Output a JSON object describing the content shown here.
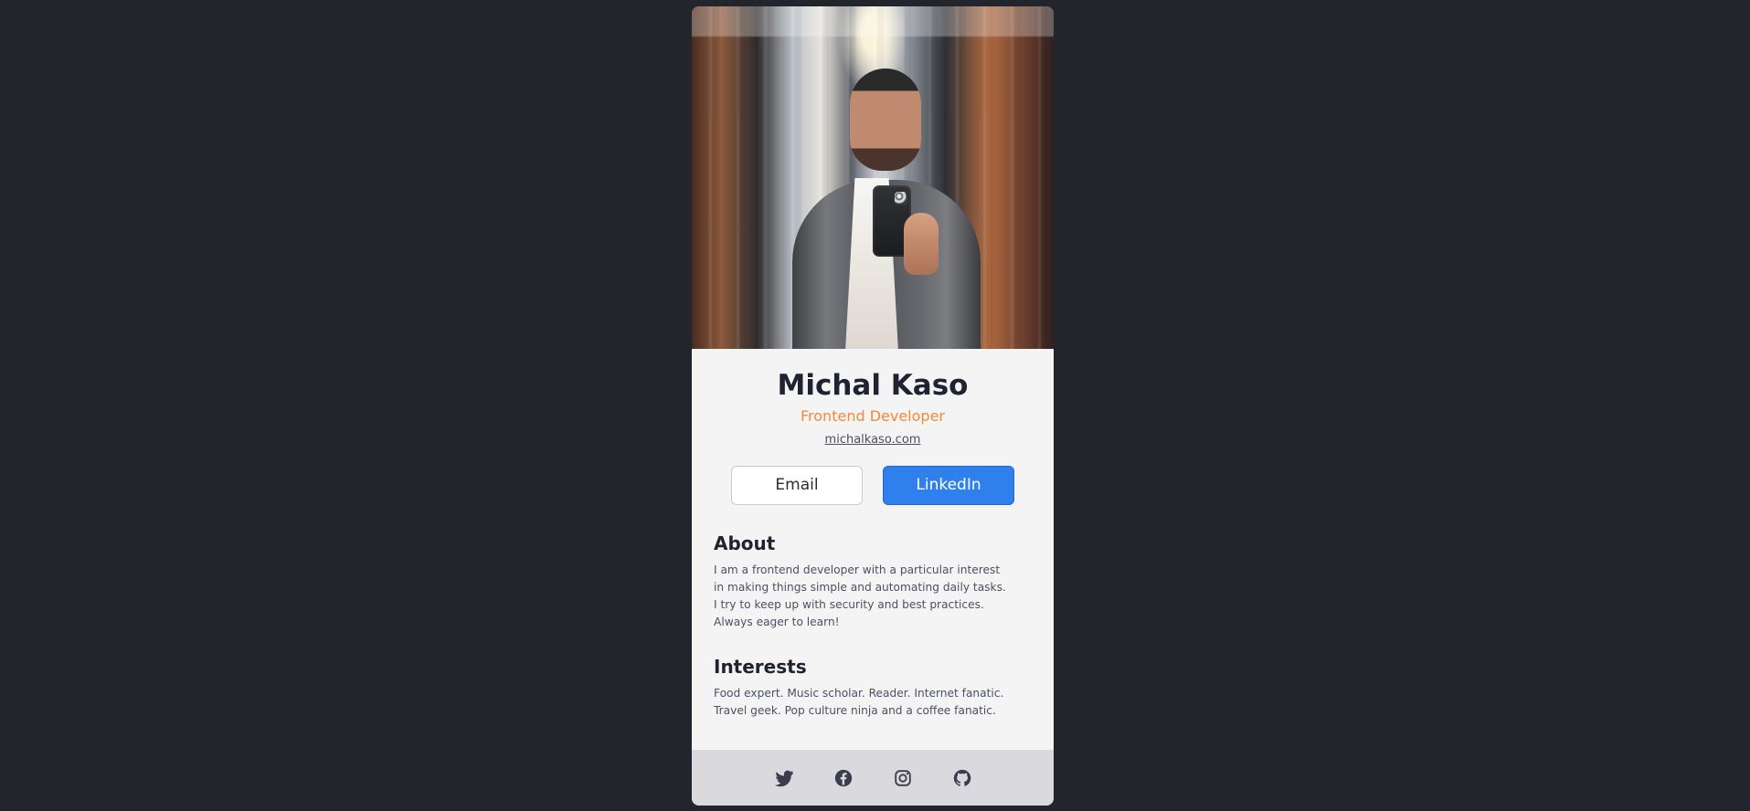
{
  "profile": {
    "name": "Michal Kaso",
    "role": "Frontend Developer",
    "website": "michalkaso.com"
  },
  "actions": {
    "email_label": "Email",
    "linkedin_label": "LinkedIn",
    "email_button_color": "#ffffff",
    "linkedin_button_color": "#2f80ed"
  },
  "sections": {
    "about": {
      "title": "About",
      "text": "I am a frontend developer with a particular interest in making things simple and automating daily tasks. I try to keep up with security and best practices. Always eager to learn!"
    },
    "interests": {
      "title": "Interests",
      "text": "Food expert. Music scholar. Reader. Internet fanatic. Travel geek. Pop culture ninja and a coffee fanatic."
    }
  },
  "footer": {
    "icons": [
      "twitter-icon",
      "facebook-icon",
      "instagram-icon",
      "github-icon"
    ]
  },
  "theme": {
    "page_background": "#23252c",
    "card_background": "#f4f4f4",
    "footer_background": "#d9d9de",
    "accent": "#f28a3a"
  }
}
